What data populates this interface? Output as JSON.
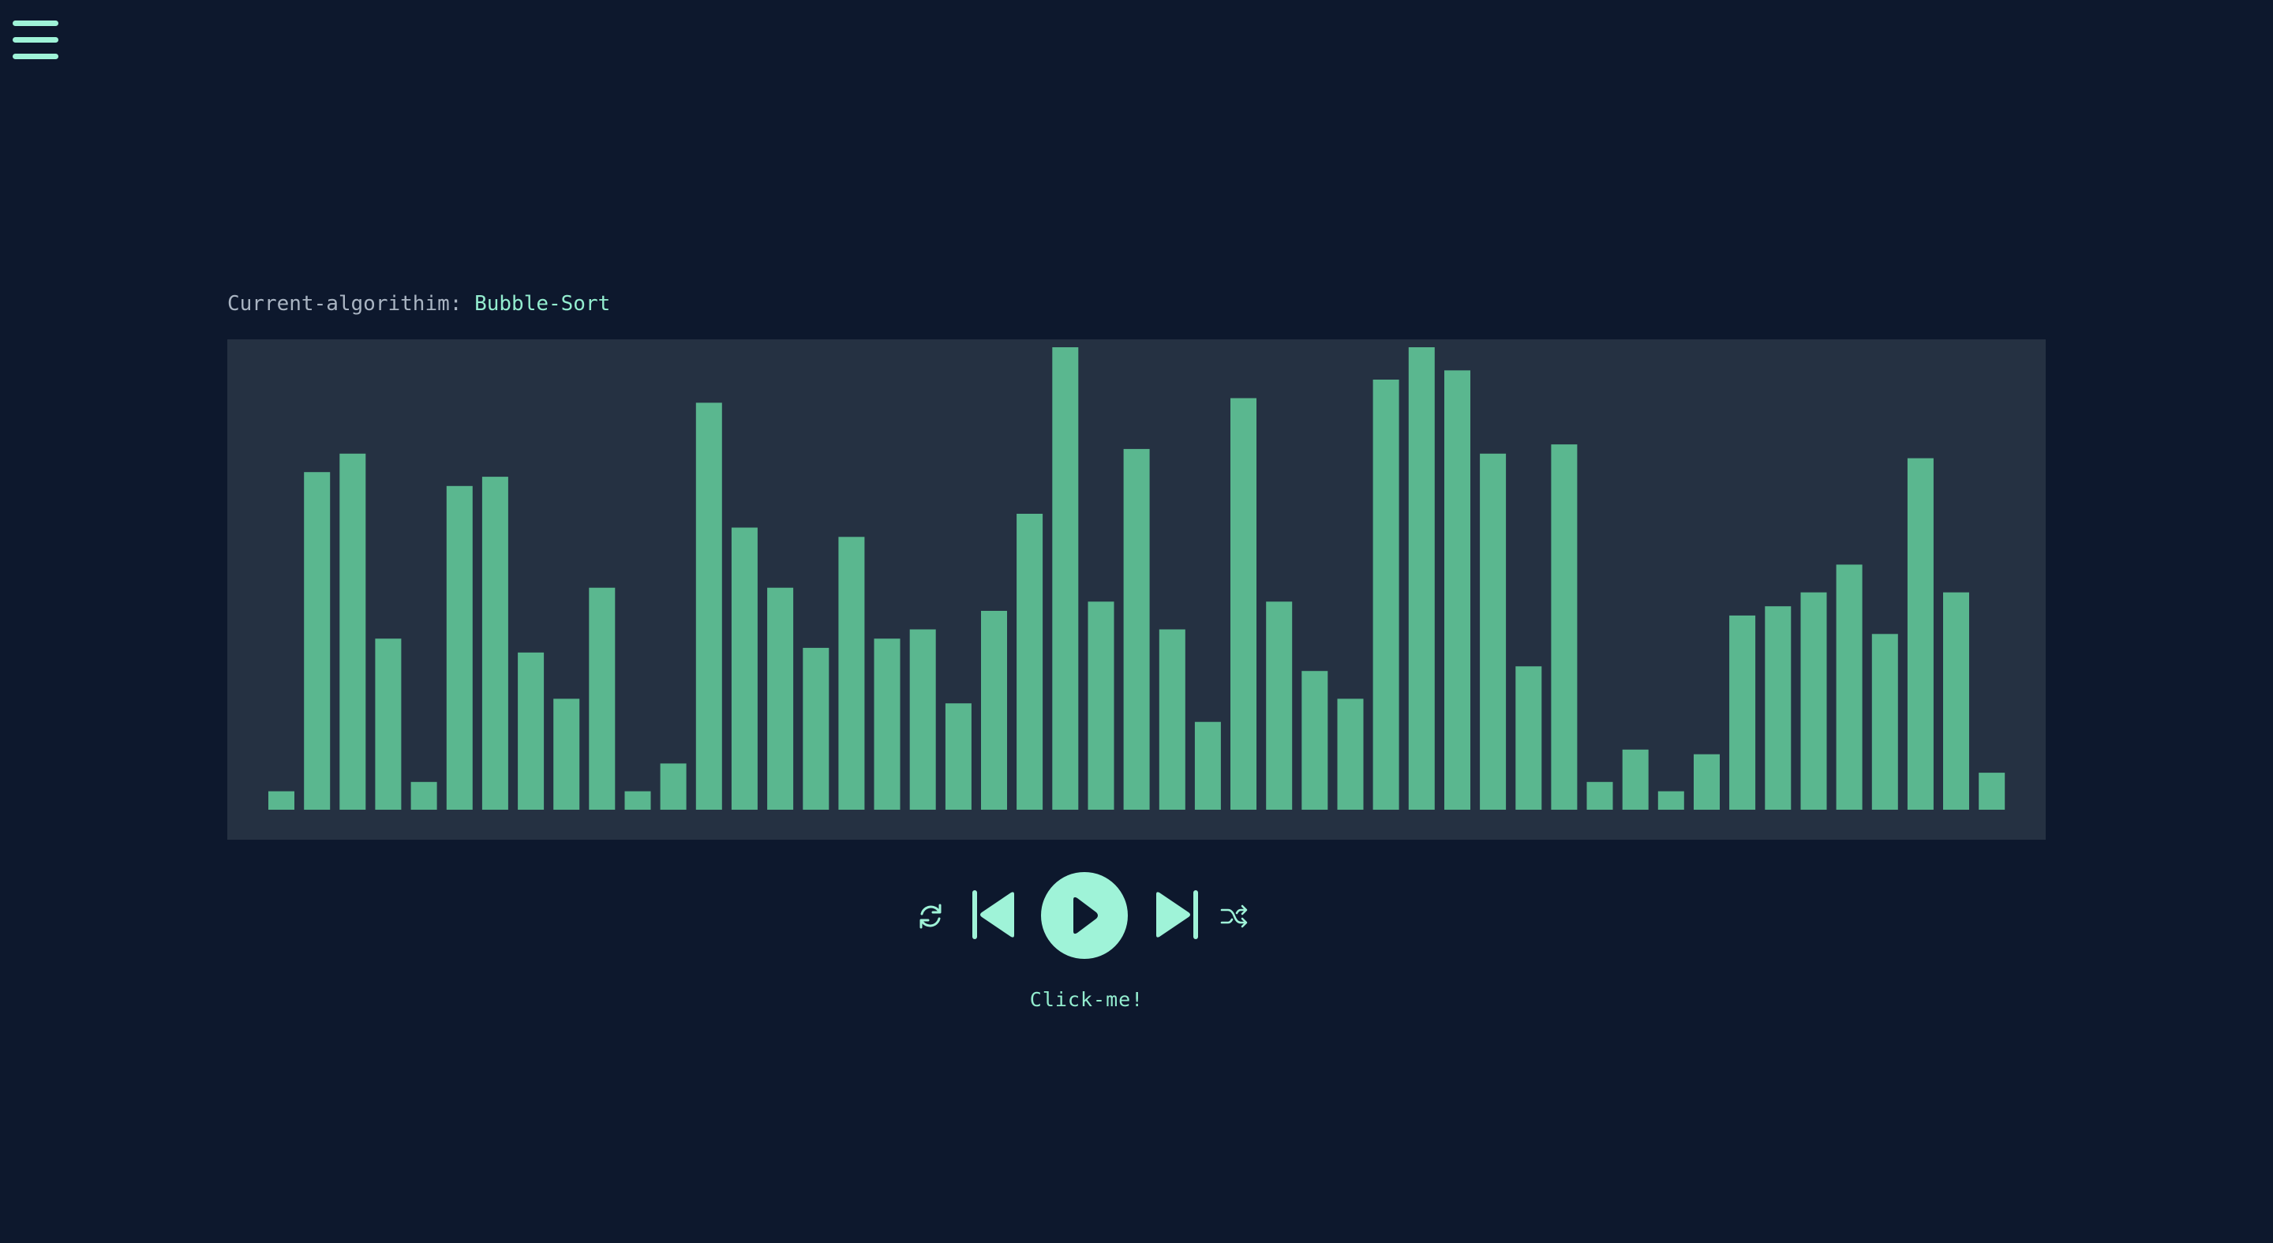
{
  "header": {
    "menu_icon": "hamburger-menu-icon"
  },
  "algorithm": {
    "label": "Current-algorithim:",
    "value": "Bubble-Sort"
  },
  "chart_data": {
    "type": "bar",
    "values": [
      4,
      73,
      77,
      37,
      6,
      70,
      72,
      34,
      24,
      48,
      4,
      10,
      88,
      61,
      48,
      35,
      59,
      37,
      39,
      23,
      43,
      64,
      100,
      45,
      78,
      39,
      19,
      89,
      45,
      30,
      24,
      93,
      100,
      95,
      77,
      31,
      79,
      6,
      13,
      4,
      12,
      42,
      44,
      47,
      53,
      38,
      76,
      47,
      8
    ],
    "ylim": [
      0,
      100
    ],
    "bar_color": "#5ab78f",
    "background": "#253142"
  },
  "controls": {
    "reset_icon": "reset-icon",
    "prev_icon": "skip-back-icon",
    "play_icon": "play-icon",
    "next_icon": "skip-forward-icon",
    "shuffle_icon": "shuffle-icon",
    "hint": "Click-me!"
  },
  "colors": {
    "page_background": "#0d182d",
    "accent": "#9ff3d8",
    "muted_text": "#a9b4c2"
  }
}
